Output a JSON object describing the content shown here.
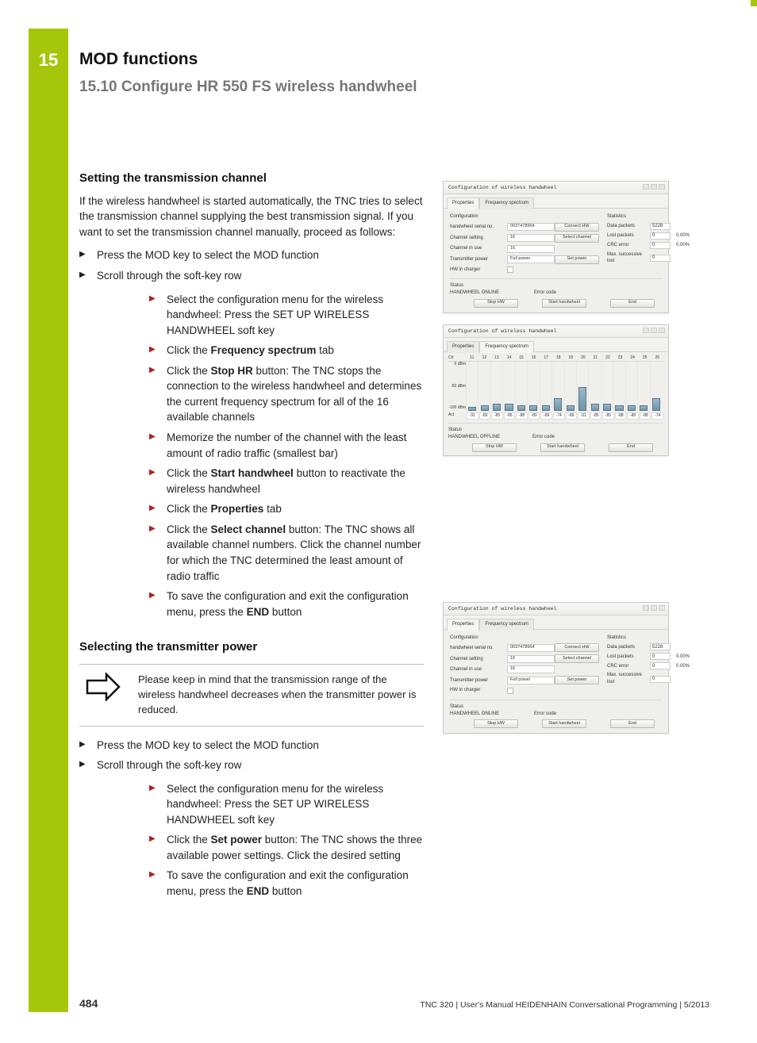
{
  "chapter": {
    "number": "15",
    "title": "MOD functions"
  },
  "section": {
    "number_title": "15.10 Configure HR 550 FS wireless handwheel"
  },
  "s1": {
    "heading": "Setting the transmission channel",
    "intro": "If the wireless handwheel is started automatically, the TNC tries to select the transmission channel supplying the best transmission signal. If you want to set the transmission channel manually, proceed as follows:",
    "a": "Press the MOD key to select the MOD function",
    "b": "Scroll through the soft-key row",
    "c1": "Select the configuration menu for the wireless handwheel: Press the SET UP WIRELESS HANDWHEEL soft key",
    "c2a": "Click the ",
    "c2b": "Frequency spectrum",
    "c2c": " tab",
    "c3a": "Click the ",
    "c3b": "Stop HR",
    "c3c": " button: The TNC stops the connection to the wireless handwheel and determines the current frequency spectrum for all of the 16 available channels",
    "c4": "Memorize the number of the channel with the least amount of radio traffic (smallest bar)",
    "c5a": "Click the ",
    "c5b": "Start handwheel",
    "c5c": " button to reactivate the wireless handwheel",
    "c6a": "Click the ",
    "c6b": "Properties",
    "c6c": " tab",
    "c7a": "Click the ",
    "c7b": "Select channel",
    "c7c": " button: The TNC shows all available channel numbers. Click the channel number for which the TNC determined the least amount of radio traffic",
    "c8a": "To save the configuration and exit the configuration menu, press the ",
    "c8b": "END",
    "c8c": " button"
  },
  "s2": {
    "heading": "Selecting the transmitter power",
    "note": "Please keep in mind that the transmission range of the wireless handwheel decreases when the transmitter power is reduced.",
    "a": "Press the MOD key to select the MOD function",
    "b": "Scroll through the soft-key row",
    "c1": "Select the configuration menu for the wireless handwheel: Press the SET UP WIRELESS HANDWHEEL soft key",
    "c2a": "Click the ",
    "c2b": "Set power",
    "c2c": " button: The TNC shows the three available power settings. Click the desired setting",
    "c3a": "To save the configuration and exit the configuration menu, press the ",
    "c3b": "END",
    "c3c": " button"
  },
  "dlg": {
    "title": "Configuration of wireless handwheel",
    "tab_props": "Properties",
    "tab_spec": "Frequency spectrum",
    "cfg_label": "Configuration",
    "stats_label": "Statistics",
    "serial_l": "handwheel serial no.",
    "serial_v": "0037478964",
    "chset_l": "Channel setting",
    "chset_v": "16",
    "chuse_l": "Channel in use",
    "chuse_v": "16",
    "txpow_l": "Transmitter power",
    "txpow_v": "Full power",
    "charger_l": "HW in charger",
    "btn_connect": "Connect HW",
    "btn_selch": "Select channel",
    "btn_setpw": "Set power",
    "st_data_l": "Data packets",
    "st_data_v": "5228",
    "st_lost_l": "Lost packets",
    "st_lost_v": "0",
    "st_lost_p": "0.00%",
    "st_crc_l": "CRC error",
    "st_crc_v": "0",
    "st_crc_p": "0.00%",
    "st_max_l": "Max. successive lost",
    "st_max_v": "0",
    "status_l": "Status",
    "status_on": "HANDWHEEL ONLINE",
    "status_off": "HANDWHEEL OFFLINE",
    "err_l": "Error code",
    "btn_stop": "Stop HW",
    "btn_start": "Start handwheel",
    "btn_end": "End"
  },
  "chart_data": {
    "type": "bar",
    "title": "Frequency spectrum",
    "xlabel": "Ch",
    "ylabel": "dBm",
    "ylim": [
      -100,
      0
    ],
    "yticks": [
      "0 dBm",
      "-50 dBm",
      "-100 dBm"
    ],
    "categories": [
      "11",
      "12",
      "13",
      "14",
      "15",
      "16",
      "17",
      "18",
      "19",
      "20",
      "21",
      "22",
      "23",
      "24",
      "25",
      "26"
    ],
    "values": [
      -91,
      -89,
      -85,
      -85,
      -88,
      -89,
      -89,
      -74,
      -89,
      -51,
      -85,
      -85,
      -88,
      -88,
      -88,
      -74
    ],
    "act_label": "Act"
  },
  "footer": {
    "page": "484",
    "line": "TNC 320 | User's Manual HEIDENHAIN Conversational Programming | 5/2013"
  }
}
